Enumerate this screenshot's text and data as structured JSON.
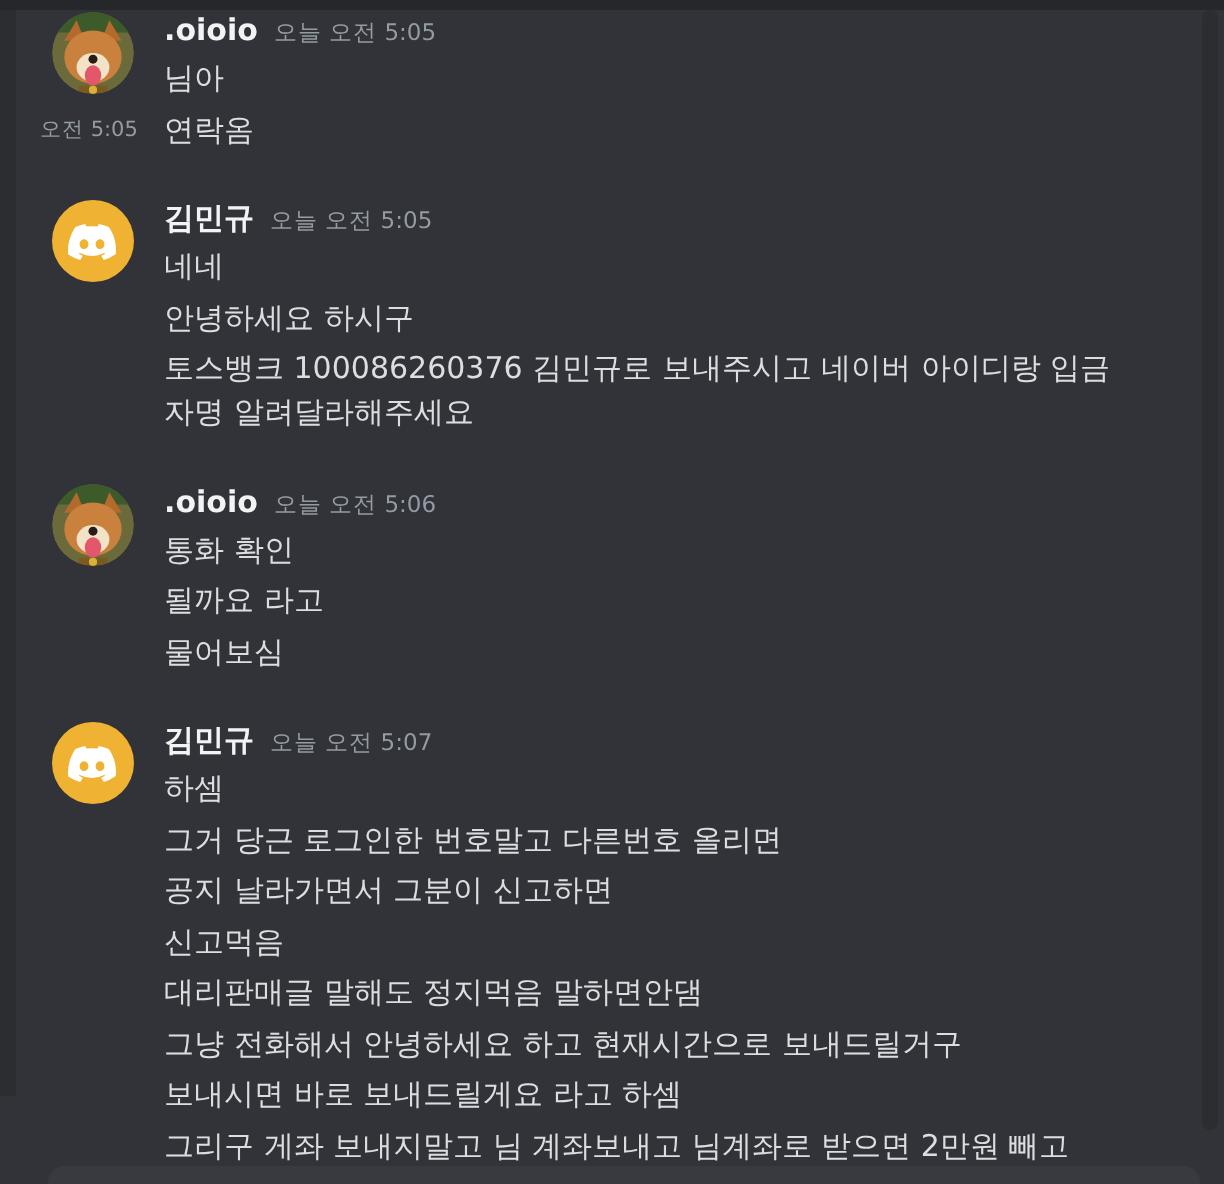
{
  "messages": [
    {
      "author": ".oioio",
      "avatar": {
        "kind": "picture"
      },
      "timestamp": "오늘 오전 5:05",
      "lines": [
        {
          "text": "님아"
        },
        {
          "text": "연락옴",
          "hover_time": "오전 5:05"
        }
      ]
    },
    {
      "author": "김민규",
      "avatar": {
        "kind": "default"
      },
      "timestamp": "오늘 오전 5:05",
      "lines": [
        {
          "text": "네네"
        },
        {
          "text": "안녕하세요 하시구"
        },
        {
          "text": "토스뱅크 100086260376 김민규로 보내주시고 네이버 아이디랑 입금자명 알려달라해주세요"
        }
      ]
    },
    {
      "author": ".oioio",
      "avatar": {
        "kind": "picture"
      },
      "timestamp": "오늘 오전 5:06",
      "lines": [
        {
          "text": "통화 확인"
        },
        {
          "text": "될까요 라고"
        },
        {
          "text": "물어보심"
        }
      ]
    },
    {
      "author": "김민규",
      "avatar": {
        "kind": "default"
      },
      "timestamp": "오늘 오전 5:07",
      "lines": [
        {
          "text": "하셈"
        },
        {
          "text": "그거 당근 로그인한 번호말고 다른번호 올리면"
        },
        {
          "text": "공지 날라가면서 그분이 신고하면"
        },
        {
          "text": "신고먹음"
        },
        {
          "text": "대리판매글 말해도 정지먹음 말하면안댐"
        },
        {
          "text": "그냥 전화해서 안녕하세요 하고 현재시간으로 보내드릴거구"
        },
        {
          "text": "보내시면 바로 보내드릴게요 라고 하셈"
        },
        {
          "text": "그리구 게좌 보내지말고 님 계좌보내고 님계좌로 받으면 2만원 빼고"
        }
      ]
    }
  ]
}
